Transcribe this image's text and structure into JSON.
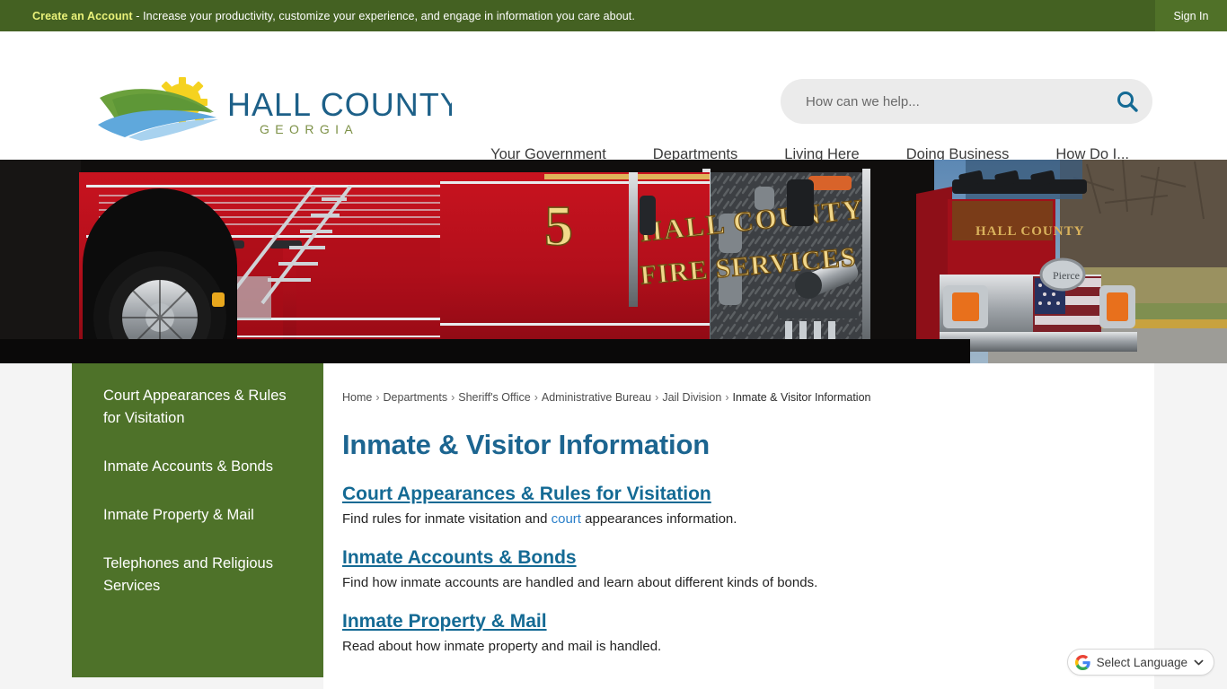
{
  "topbar": {
    "account_link": "Create an Account",
    "message": " - Increase your productivity, customize your experience, and engage in information you care about.",
    "signin_label": "Sign In"
  },
  "header": {
    "logo_title": "HALL COUNTY",
    "logo_subtitle": "GEORGIA",
    "search_placeholder": "How can we help...",
    "search_value": "",
    "search_icon": "search-icon",
    "nav": [
      {
        "label": "Your Government"
      },
      {
        "label": "Departments"
      },
      {
        "label": "Living Here"
      },
      {
        "label": "Doing Business"
      },
      {
        "label": "How Do I..."
      }
    ]
  },
  "hero": {
    "alt": "Hall County Fire Services fire engine",
    "truck_number": "5",
    "truck_text_line1": "HALL COUNTY",
    "truck_text_line2": "FIRE SERVICES",
    "second_truck_text": "HALL COUNTY"
  },
  "sidebar": {
    "items": [
      {
        "label": "Court Appearances & Rules for Visitation"
      },
      {
        "label": "Inmate Accounts & Bonds"
      },
      {
        "label": "Inmate Property & Mail"
      },
      {
        "label": "Telephones and Religious Services"
      }
    ]
  },
  "breadcrumb": {
    "items": [
      {
        "label": "Home"
      },
      {
        "label": "Departments"
      },
      {
        "label": "Sheriff's Office"
      },
      {
        "label": "Administrative Bureau"
      },
      {
        "label": "Jail Division"
      },
      {
        "label": "Inmate & Visitor Information"
      }
    ],
    "separator": "›"
  },
  "main": {
    "title": "Inmate & Visitor Information",
    "sections": [
      {
        "heading": "Court Appearances & Rules for Visitation",
        "text_before": "Find rules for inmate visitation and ",
        "link": "court",
        "text_after": " appearances information."
      },
      {
        "heading": "Inmate Accounts & Bonds",
        "text_before": "Find how inmate accounts are handled and learn about different kinds of bonds.",
        "link": "",
        "text_after": ""
      },
      {
        "heading": "Inmate Property & Mail",
        "text_before": "Read about how inmate property and mail is handled.",
        "link": "",
        "text_after": ""
      }
    ]
  },
  "translate": {
    "label": "Select Language",
    "logo_icon": "google-g-icon",
    "chevron_icon": "chevron-down-icon"
  },
  "colors": {
    "topbar_green": "#446122",
    "signin_green": "#507128",
    "sidebar_green": "#4e7229",
    "title_blue": "#1c6590",
    "link_blue": "#146a94",
    "inline_link_blue": "#2a7fc9",
    "accent_yellow": "#eaf27a",
    "page_bg": "#f4f4f4"
  }
}
